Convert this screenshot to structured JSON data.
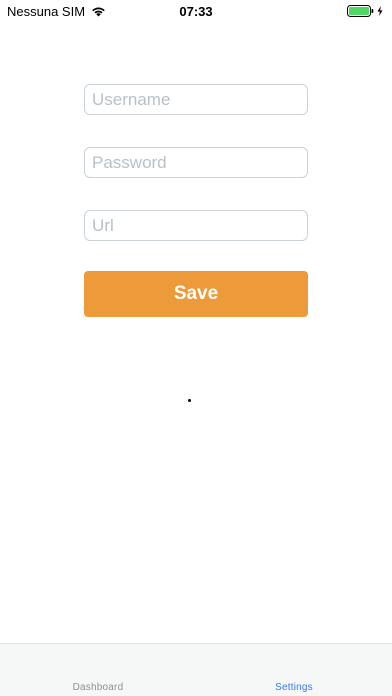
{
  "status_bar": {
    "carrier": "Nessuna SIM",
    "time": "07:33",
    "wifi_icon": "wifi-icon",
    "battery_icon": "battery-charging-icon"
  },
  "form": {
    "username_placeholder": "Username",
    "password_placeholder": "Password",
    "url_placeholder": "Url",
    "save_label": "Save"
  },
  "tab_bar": {
    "tabs": [
      {
        "label": "Dashboard",
        "active": false
      },
      {
        "label": "Settings",
        "active": true
      }
    ]
  },
  "colors": {
    "accent": "#ed9a3a",
    "active_tab": "#3478f6",
    "inactive_tab": "#8e8e93",
    "battery": "#4cd964"
  }
}
